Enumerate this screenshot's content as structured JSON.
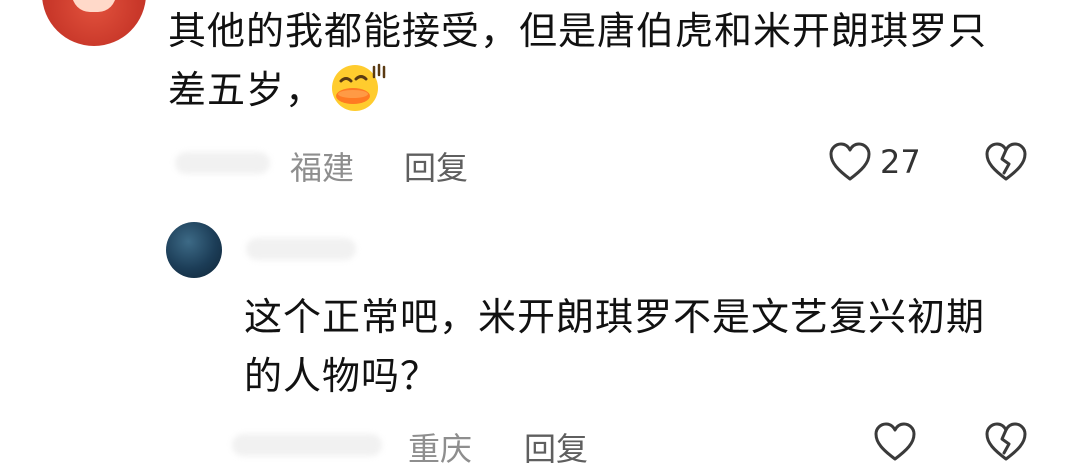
{
  "comments": [
    {
      "text_line1": "其他的我都能接受，但是唐伯虎和米开朗琪罗只",
      "text_line2": "差五岁，",
      "emoji": "laughing-duck-emoji",
      "location": "福建",
      "reply_label": "回复",
      "like_count": "27"
    },
    {
      "text_line1": "这个正常吧，米开朗琪罗不是文艺复兴初期",
      "text_line2": "的人物吗？",
      "location": "重庆",
      "reply_label": "回复"
    }
  ],
  "icons": {
    "like": "heart-outline-icon",
    "dislike": "broken-heart-icon"
  },
  "colors": {
    "text": "#111111",
    "meta": "#8e8e8e",
    "icon": "#3a3a3a"
  }
}
